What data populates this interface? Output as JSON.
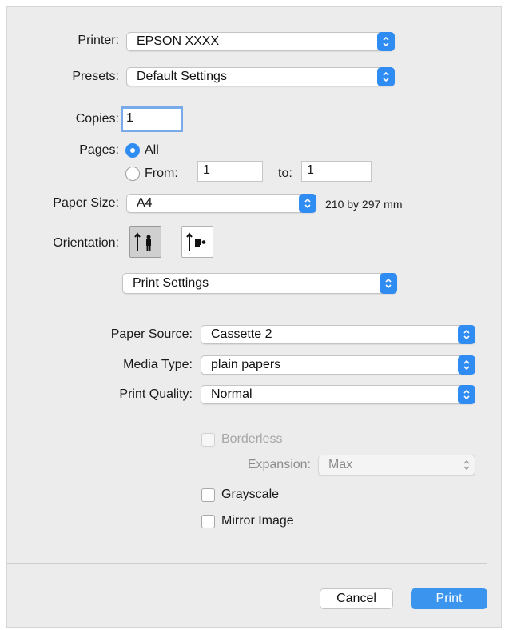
{
  "printer": {
    "label": "Printer:",
    "value": "EPSON XXXX"
  },
  "presets": {
    "label": "Presets:",
    "value": "Default Settings"
  },
  "copies": {
    "label": "Copies:",
    "value": "1"
  },
  "pages": {
    "label": "Pages:",
    "all_label": "All",
    "from_label": "From:",
    "from_value": "1",
    "to_label": "to:",
    "to_value": "1",
    "selected": "All"
  },
  "paper_size": {
    "label": "Paper Size:",
    "value": "A4",
    "dimensions": "210 by 297 mm"
  },
  "orientation": {
    "label": "Orientation:",
    "selected": "portrait"
  },
  "section_popup": {
    "value": "Print Settings"
  },
  "paper_source": {
    "label": "Paper Source:",
    "value": "Cassette 2"
  },
  "media_type": {
    "label": "Media Type:",
    "value": "plain papers"
  },
  "print_quality": {
    "label": "Print Quality:",
    "value": "Normal"
  },
  "borderless": {
    "label": "Borderless",
    "checked": false,
    "enabled": false
  },
  "expansion": {
    "label": "Expansion:",
    "value": "Max",
    "enabled": false
  },
  "grayscale": {
    "label": "Grayscale",
    "checked": false
  },
  "mirror_image": {
    "label": "Mirror Image",
    "checked": false
  },
  "buttons": {
    "cancel": "Cancel",
    "print": "Print"
  },
  "colors": {
    "accent": "#2f8cf3",
    "print_button": "#3b94ee",
    "dialog_bg": "#ececec"
  }
}
